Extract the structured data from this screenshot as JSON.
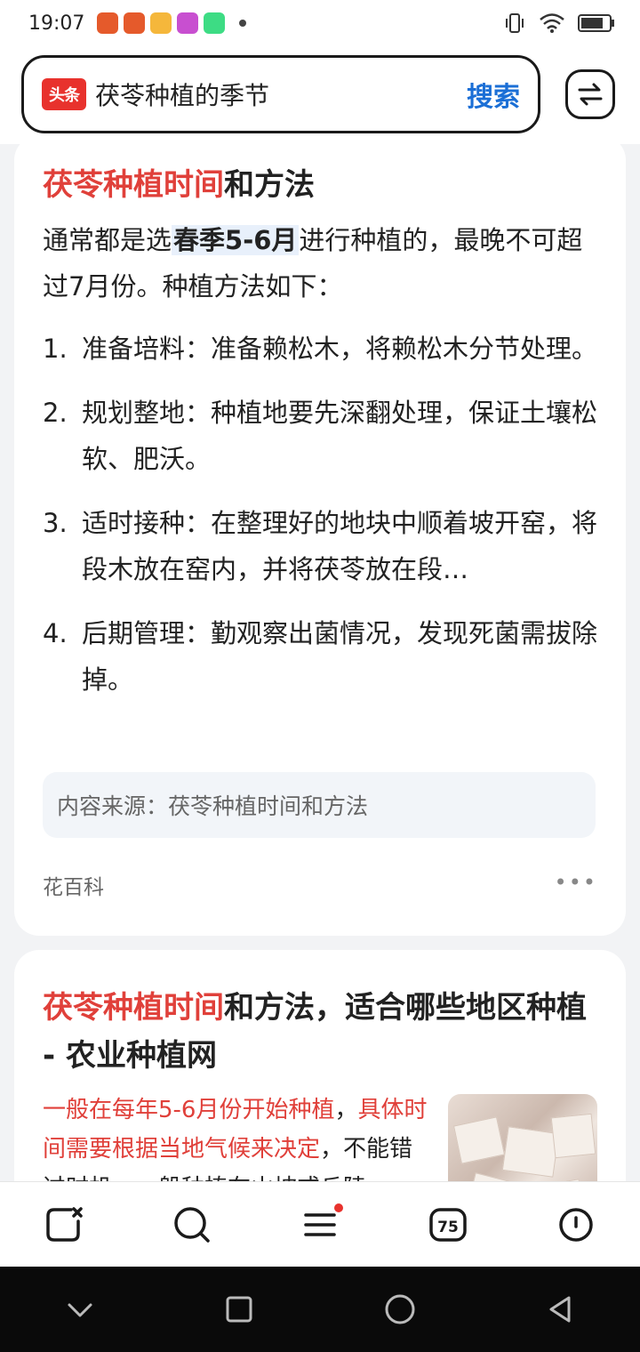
{
  "status_bar": {
    "time": "19:07",
    "notification_icons": [
      "app-badge-icon",
      "app-badge-icon",
      "weather-icon",
      "camera-app-icon",
      "android-icon"
    ],
    "colors": {
      "badge": "#e55a2b",
      "weather": "#f5b73b",
      "camera": "#c84fd0",
      "android": "#3ddc84"
    }
  },
  "search": {
    "logo_text": "头条",
    "query": "茯苓种植的季节",
    "button_label": "搜索"
  },
  "card1": {
    "title_highlight": "茯苓种植时间",
    "title_rest": "和方法",
    "intro_before": "通常都是选",
    "intro_highlight": "春季5-6月",
    "intro_after": "进行种植的，最晚不可超过7月份。种植方法如下：",
    "steps": [
      {
        "num": "1.",
        "text": "准备培料：准备赖松木，将赖松木分节处理。"
      },
      {
        "num": "2.",
        "text": "规划整地：种植地要先深翻处理，保证土壤松软、肥沃。"
      },
      {
        "num": "3.",
        "text": "适时接种：在整理好的地块中顺着坡开窑，将段木放在窑内，并将茯苓放在段…"
      },
      {
        "num": "4.",
        "text": "后期管理：勤观察出菌情况，发现死菌需拔除掉。"
      }
    ],
    "source": "内容来源：茯苓种植时间和方法",
    "author": "花百科",
    "more": "•••"
  },
  "card2": {
    "title_highlight": "茯苓种植时间",
    "title_rest": "和方法，适合哪些地区种植 - 农业种植网",
    "body_red_1": "一般在每年5-6月份开始种植",
    "body_sep": "，",
    "body_red_2": "具体时间需要根据当地气候来决定",
    "body_rest": "，不能错过时机，一般种植在山坡或丘陵"
  },
  "bottom_nav": {
    "tabs_badge": "75"
  },
  "colors": {
    "accent_blue": "#1b6fd6",
    "highlight_red": "#e0403a",
    "logo_red": "#e8322d"
  }
}
